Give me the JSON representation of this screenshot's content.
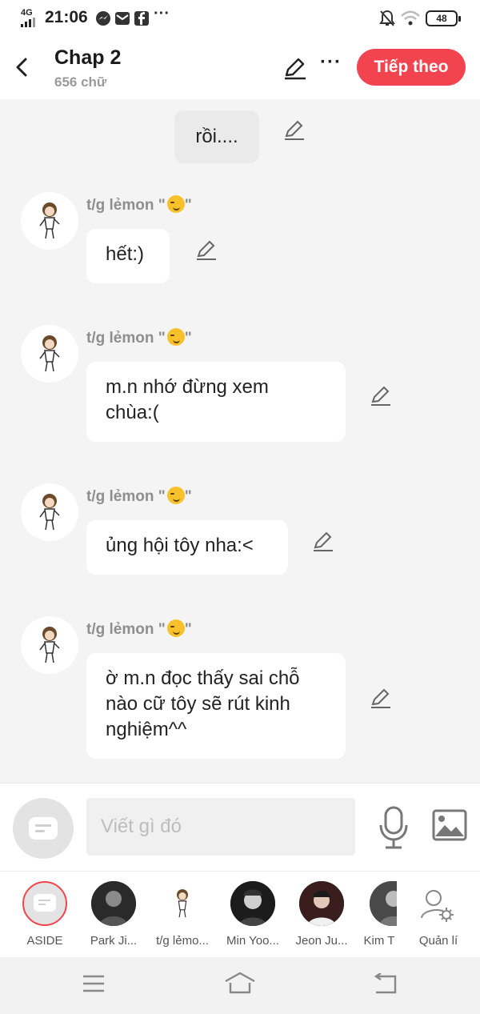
{
  "status_bar": {
    "network": "4G",
    "time": "21:06",
    "battery": "48"
  },
  "header": {
    "title": "Chap 2",
    "word_count": "656 chữ",
    "next_label": "Tiếp theo"
  },
  "messages": [
    {
      "author": "",
      "text": "rồi....",
      "align": "center"
    },
    {
      "author": "t/g lẻmon \"",
      "author_end": "\"",
      "text": "hết:)"
    },
    {
      "author": "t/g lẻmon \"",
      "author_end": "\"",
      "text_lines": [
        "m.n nhớ đừng xem",
        "chùa:("
      ]
    },
    {
      "author": "t/g lẻmon \"",
      "author_end": "\"",
      "text": "ủng hội tôy nha:<"
    },
    {
      "author": "t/g lẻmon \"",
      "author_end": "\"",
      "text_lines": [
        "ờ m.n đọc thấy sai chỗ",
        "nào cữ tôy sẽ rút kinh",
        "nghiệm^^"
      ]
    }
  ],
  "composer": {
    "placeholder": "Viết gì đó"
  },
  "characters": [
    {
      "name": "ASIDE",
      "icon": "aside-icon"
    },
    {
      "name": "Park Ji...",
      "icon": "avatar-dark"
    },
    {
      "name": "t/g lẻmo...",
      "icon": "avatar-sticker"
    },
    {
      "name": "Min Yoo...",
      "icon": "avatar-dark"
    },
    {
      "name": "Jeon Ju...",
      "icon": "avatar-dark"
    },
    {
      "name": "Kim T",
      "icon": "avatar-dark"
    },
    {
      "name": "Quản lí",
      "icon": "manage-icon"
    }
  ],
  "colors": {
    "accent": "#f2444e",
    "background": "#f4f4f4",
    "bubble": "#ffffff"
  }
}
